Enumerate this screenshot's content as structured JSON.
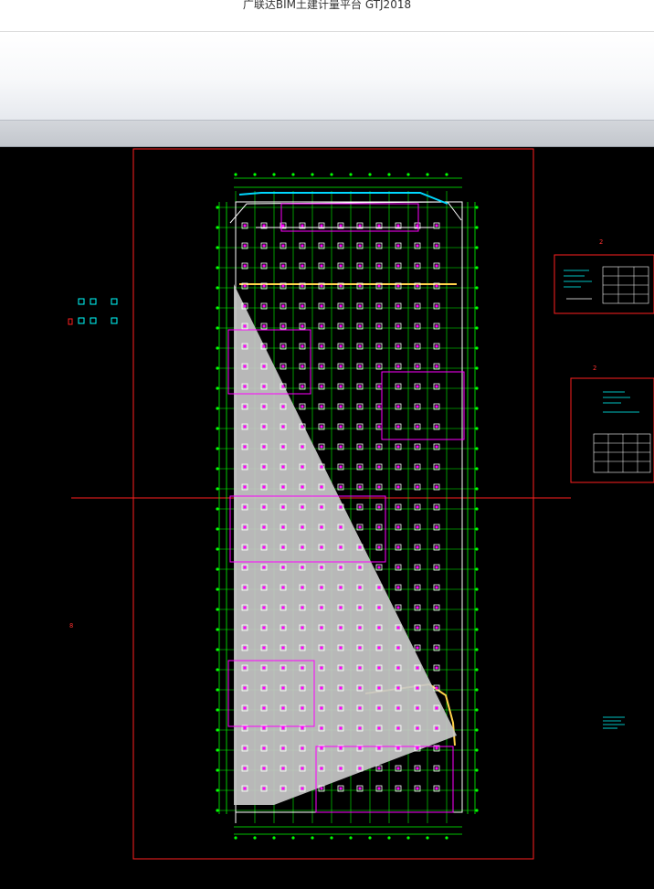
{
  "window": {
    "title": "广联达BIM土建计量平台 GTJ2018"
  },
  "cad": {
    "colors": {
      "background": "#000000",
      "frame": "#ff2020",
      "axis": "#00ff00",
      "column": "#ff00ff",
      "wall": "#ffffff",
      "beam": "#ffd24a",
      "selection": "#c8c8c8",
      "label": "#00ffff"
    },
    "labels": {
      "left_mark": "8",
      "right_mark_1": "2",
      "right_mark_2": "2"
    }
  }
}
